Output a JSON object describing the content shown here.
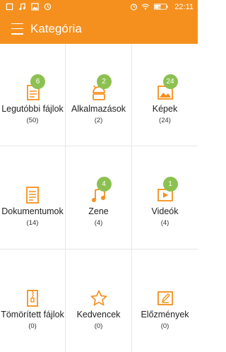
{
  "status_bar": {
    "time": "22:11",
    "battery": "48"
  },
  "header": {
    "title": "Kategória"
  },
  "categories": [
    {
      "label": "Legutóbbi fájlok",
      "count": "(50)",
      "badge": "6"
    },
    {
      "label": "Alkalmazások",
      "count": "(2)",
      "badge": "2"
    },
    {
      "label": "Képek",
      "count": "(24)",
      "badge": "24"
    },
    {
      "label": "Dokumentumok",
      "count": "(14)",
      "badge": ""
    },
    {
      "label": "Zene",
      "count": "(4)",
      "badge": "4"
    },
    {
      "label": "Videók",
      "count": "(4)",
      "badge": "1"
    },
    {
      "label": "Tömörített fájlok",
      "count": "(0)",
      "badge": ""
    },
    {
      "label": "Kedvencek",
      "count": "(0)",
      "badge": ""
    },
    {
      "label": "Előzmények",
      "count": "(0)",
      "badge": ""
    }
  ],
  "colors": {
    "accent": "#f5901e",
    "badge": "#8cc152"
  }
}
